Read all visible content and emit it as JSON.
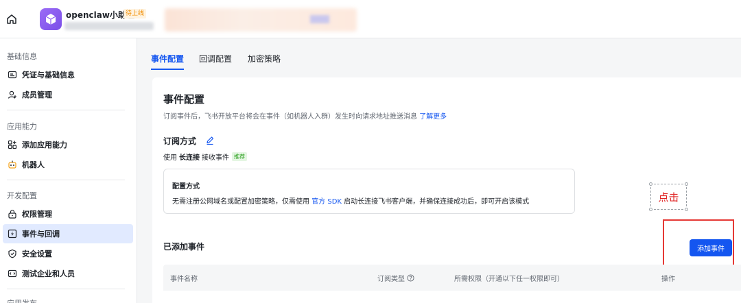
{
  "app": {
    "name": "openclaw小助理",
    "badge": "待上线"
  },
  "sidebar": {
    "sections": [
      {
        "title": "基础信息",
        "items": [
          {
            "label": "凭证与基础信息",
            "icon": "credential-icon"
          },
          {
            "label": "成员管理",
            "icon": "member-icon"
          }
        ]
      },
      {
        "title": "应用能力",
        "items": [
          {
            "label": "添加应用能力",
            "icon": "apps-add-icon"
          },
          {
            "label": "机器人",
            "icon": "robot-icon"
          }
        ]
      },
      {
        "title": "开发配置",
        "items": [
          {
            "label": "权限管理",
            "icon": "lock-icon"
          },
          {
            "label": "事件与回调",
            "icon": "event-icon",
            "active": true
          },
          {
            "label": "安全设置",
            "icon": "shield-icon"
          },
          {
            "label": "测试企业和人员",
            "icon": "test-icon"
          }
        ]
      },
      {
        "title": "应用发布"
      }
    ]
  },
  "tabs": [
    {
      "label": "事件配置",
      "active": true
    },
    {
      "label": "回调配置"
    },
    {
      "label": "加密策略"
    }
  ],
  "event_config": {
    "title": "事件配置",
    "desc": "订阅事件后，飞书开放平台将会在事件（如机器人入群）发生时向请求地址推送消息",
    "learn_more": "了解更多",
    "subscribe_title": "订阅方式",
    "use_prefix": "使用",
    "use_mode": "长连接",
    "use_suffix": "接收事件",
    "recommend": "推荐",
    "mode_box_title": "配置方式",
    "mode_desc_prefix": "无需注册公网域名或配置加密策略，仅需使用",
    "mode_desc_link": "官方 SDK",
    "mode_desc_suffix": "启动长连接飞书客户端，并确保连接成功后，即可开启该模式"
  },
  "added": {
    "title": "已添加事件",
    "add_button": "添加事件",
    "columns": {
      "name": "事件名称",
      "type": "订阅类型",
      "scope": "所需权限（开通以下任一权限即可）",
      "action": "操作"
    }
  },
  "annotation": {
    "click_label": "点击"
  },
  "colors": {
    "primary": "#1456f0",
    "annotation_red": "#e53935",
    "active_bg": "#e1eaff"
  }
}
